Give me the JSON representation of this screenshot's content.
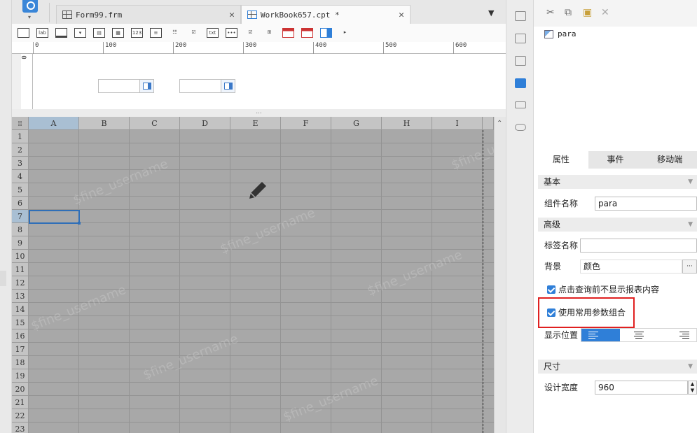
{
  "tabs": [
    {
      "label": "Form99.frm",
      "active": false
    },
    {
      "label": "WorkBook657.cpt *",
      "active": true
    }
  ],
  "toolbar": {
    "items": [
      "text-widget-icon",
      "label-widget-icon",
      "textarea-widget-icon",
      "combobox-widget-icon",
      "date-widget-icon",
      "calendar-widget-icon",
      "number-widget-icon",
      "list-widget-icon",
      "checkbox-group-icon",
      "checkbox-icon",
      "file-upload-icon",
      "password-widget-icon",
      "treelist-icon",
      "tree-combo-icon",
      "date-red-icon",
      "datetime-red-icon",
      "dropdown-blue-icon",
      "more-icon"
    ],
    "labels": {
      "lab": "lab",
      "num": "123",
      "txt": "txt"
    }
  },
  "ruler": {
    "h": [
      "0",
      "100",
      "200",
      "300",
      "400",
      "500",
      "600"
    ],
    "v": "0"
  },
  "divider": "...",
  "grid": {
    "columns": [
      "A",
      "B",
      "C",
      "D",
      "E",
      "F",
      "G",
      "H",
      "I"
    ],
    "rows": [
      "1",
      "2",
      "3",
      "4",
      "5",
      "6",
      "7",
      "8",
      "9",
      "10",
      "11",
      "12",
      "13",
      "14",
      "15",
      "16",
      "17",
      "18",
      "19",
      "20",
      "21",
      "22",
      "23"
    ],
    "selected_cell": "A7"
  },
  "watermark": "$fine_username",
  "tree": {
    "item": "para"
  },
  "property_tabs": [
    {
      "label": "属性",
      "active": true
    },
    {
      "label": "事件",
      "active": false
    },
    {
      "label": "移动端",
      "active": false
    }
  ],
  "props": {
    "basic_section": "基本",
    "name_label": "组件名称",
    "name_value": "para",
    "advanced_section": "高级",
    "tagname_label": "标签名称",
    "tagname_value": "",
    "background_label": "背景",
    "background_value": "颜色",
    "more_btn": "···",
    "check1": "点击查询前不显示报表内容",
    "check2": "使用常用参数组合",
    "position_label": "显示位置",
    "size_section": "尺寸",
    "width_label": "设计宽度",
    "width_value": "960"
  },
  "colors": {
    "accent": "#2f7fd8",
    "highlight": "#e02020",
    "grid": "#a8a8a8"
  }
}
